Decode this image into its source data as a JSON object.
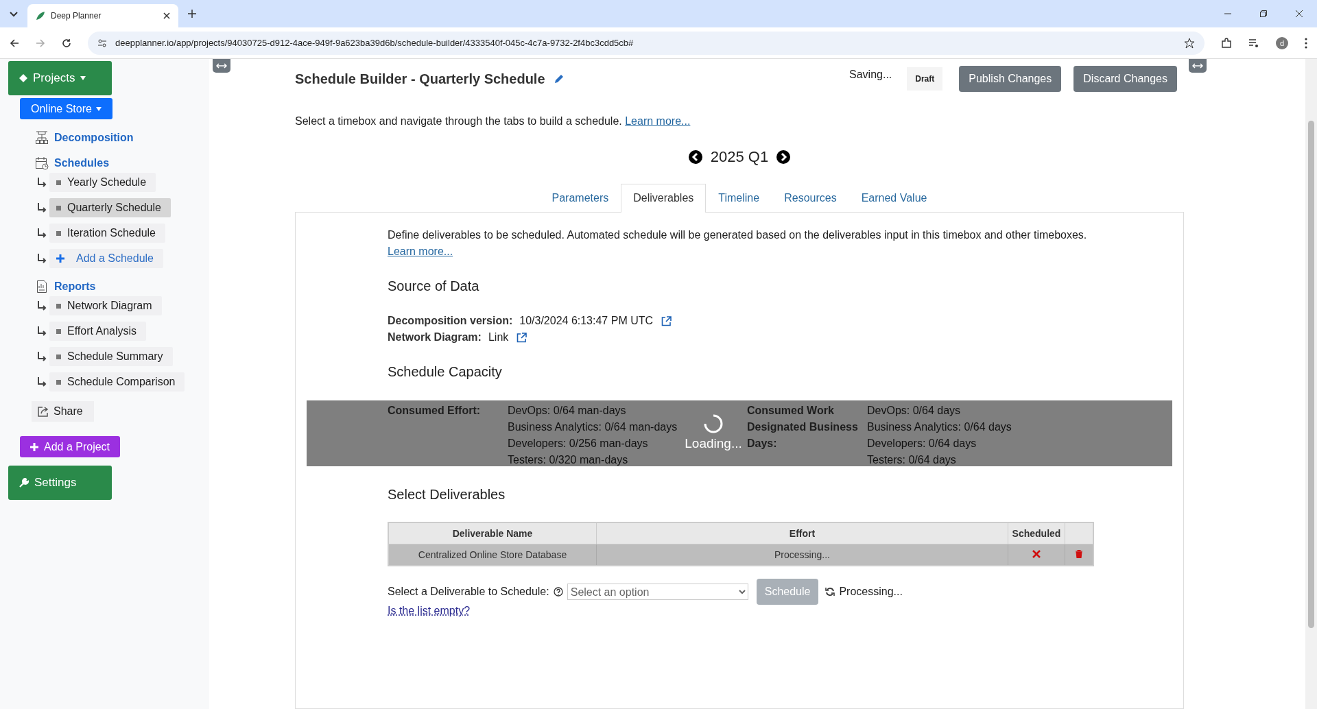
{
  "browser": {
    "tab_title": "Deep Planner",
    "url": "deepplanner.io/app/projects/94030725-d912-4ace-949f-9a623ba39d6b/schedule-builder/4333540f-045c-4c7a-9732-2f4bc3cdd5cb#",
    "avatar": "d"
  },
  "sidebar": {
    "projects_button": "Projects",
    "project_button": "Online Store",
    "sections": [
      {
        "kind": "decomposition",
        "label": "Decomposition"
      },
      {
        "kind": "schedules",
        "label": "Schedules",
        "items": [
          {
            "kind": "page",
            "label": "Yearly Schedule",
            "selected": false
          },
          {
            "kind": "page",
            "label": "Quarterly Schedule",
            "selected": true
          },
          {
            "kind": "page",
            "label": "Iteration Schedule",
            "selected": false
          },
          {
            "kind": "add",
            "label": "Add a Schedule",
            "selected": false
          }
        ]
      },
      {
        "kind": "reports",
        "label": "Reports",
        "items": [
          {
            "kind": "page",
            "label": "Network Diagram",
            "selected": false
          },
          {
            "kind": "page",
            "label": "Effort Analysis",
            "selected": false
          },
          {
            "kind": "page",
            "label": "Schedule Summary",
            "selected": false
          },
          {
            "kind": "page",
            "label": "Schedule Comparison",
            "selected": false
          }
        ]
      }
    ],
    "share": "Share",
    "add_project": "Add a Project",
    "settings": "Settings"
  },
  "header": {
    "title": "Schedule Builder - Quarterly Schedule",
    "status": "Saving...",
    "draft": "Draft",
    "buttons": [
      "Publish Changes",
      "Discard Changes"
    ]
  },
  "intro": {
    "text": "Select a timebox and navigate through the tabs to build a schedule.",
    "link": "Learn more..."
  },
  "timebox": "2025 Q1",
  "tabs": [
    {
      "label": "Parameters",
      "selected": false
    },
    {
      "label": "Deliverables",
      "selected": true
    },
    {
      "label": "Timeline",
      "selected": false
    },
    {
      "label": "Resources",
      "selected": false
    },
    {
      "label": "Earned Value",
      "selected": false
    }
  ],
  "deliverables": {
    "description": "Define deliverables to be scheduled. Automated schedule will be generated based on the deliverables input in this timebox and other timeboxes.",
    "learn_more": "Learn more...",
    "source_heading": "Source of Data",
    "sources": [
      {
        "label": "Decomposition version:",
        "value": "10/3/2024 6:13:47 PM UTC"
      },
      {
        "label": "Network Diagram:",
        "value": "Link"
      }
    ],
    "capacity_heading": "Schedule Capacity",
    "capacity": [
      {
        "label": "Consumed Effort:",
        "lines": [
          "DevOps: 0/64 man-days",
          "Business Analytics: 0/64 man-days",
          "Developers: 0/256 man-days",
          "Testers: 0/320 man-days"
        ]
      },
      {
        "label": "Consumed Work Designated Business Days:",
        "lines": [
          "DevOps: 0/64 days",
          "Business Analytics: 0/64 days",
          "Developers: 0/64 days",
          "Testers: 0/64 days"
        ]
      }
    ],
    "loading": "Loading...",
    "select_heading": "Select Deliverables",
    "columns": [
      "Deliverable Name",
      "Effort",
      "Scheduled"
    ],
    "rows": [
      {
        "name": "Centralized Online Store Database",
        "effort": "Processing...",
        "scheduled": false
      }
    ],
    "select_label": "Select a Deliverable to Schedule:",
    "select_placeholder": "Select an option",
    "schedule_button": "Schedule",
    "processing": "Processing...",
    "empty_link": "Is the list empty?"
  }
}
